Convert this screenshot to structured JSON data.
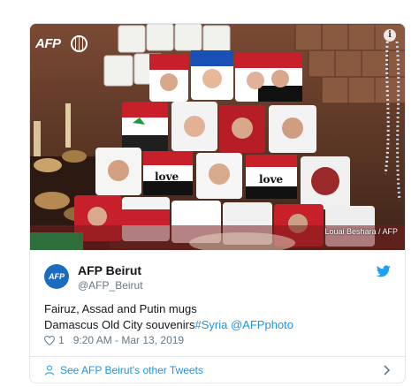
{
  "media": {
    "watermark": "AFP",
    "photo_credit": "Louai Beshara / AFP",
    "mug_text": [
      "love",
      "love"
    ],
    "info_glyph": "i"
  },
  "author": {
    "avatar_text": "AFP",
    "name": "AFP Beirut",
    "handle": "@AFP_Beirut"
  },
  "tweet": {
    "line1": "Fairuz, Assad and Putin mugs",
    "line2_text": "Damascus Old City souvenirs",
    "hashtag": "#Syria",
    "mention": "@AFPphoto"
  },
  "meta": {
    "likes": "1",
    "timestamp": "9:20 AM - Mar 13, 2019"
  },
  "footer": {
    "other_tweets_label": "See AFP Beirut's other Tweets"
  },
  "colors": {
    "link": "#1b95e0",
    "secondary_text": "#657786",
    "border": "#e1e8ed",
    "avatar": "#1b6bbf"
  },
  "icons": [
    "info-icon",
    "twitter-bird-icon",
    "heart-icon",
    "person-icon",
    "chevron-right-icon"
  ]
}
